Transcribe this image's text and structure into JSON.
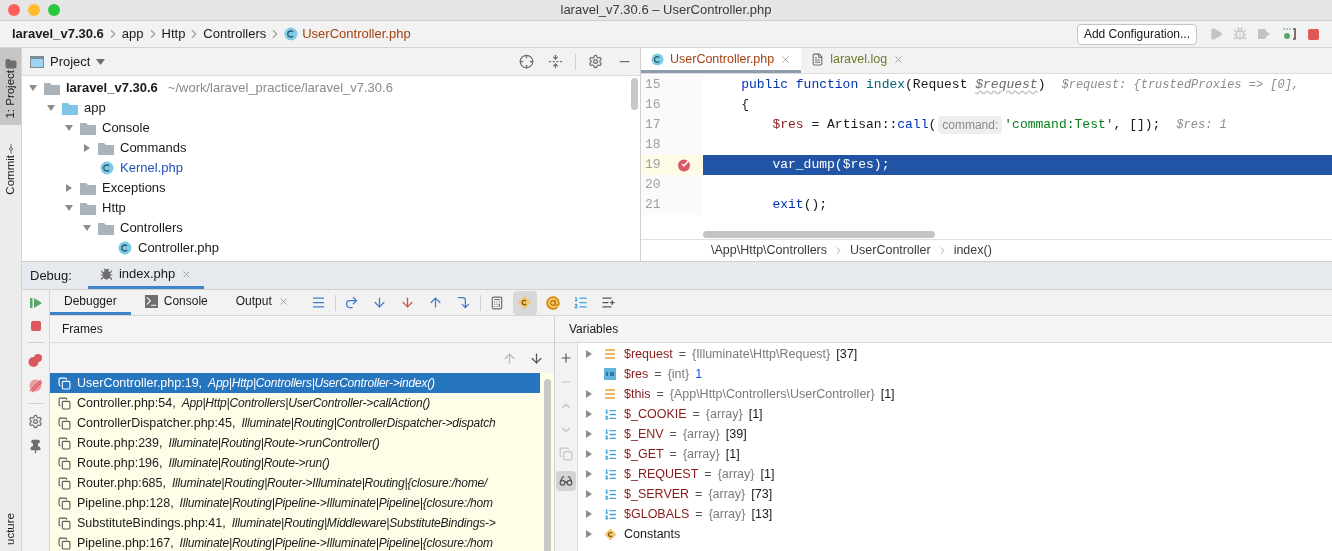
{
  "window": {
    "title": "laravel_v7.30.6 – UserController.php"
  },
  "navbar": {
    "breadcrumbs": [
      {
        "label": "laravel_v7.30.6",
        "kind": "project"
      },
      {
        "label": "app",
        "kind": "folder"
      },
      {
        "label": "Http",
        "kind": "folder"
      },
      {
        "label": "Controllers",
        "kind": "folder"
      },
      {
        "label": "UserController.php",
        "kind": "php"
      }
    ],
    "run_config": "Add Configuration..."
  },
  "tool_strip": {
    "tabs": [
      {
        "label": "1: Project",
        "selected": true,
        "kind": "project"
      },
      {
        "label": "Commit",
        "selected": false,
        "kind": "commit"
      },
      {
        "label": "ucture",
        "selected": false,
        "kind": "plain"
      }
    ]
  },
  "project": {
    "title": "Project",
    "tree": [
      {
        "label": "laravel_v7.30.6",
        "path": "~/work/laravel_practice/laravel_v7.30.6",
        "kind": "root",
        "expanded": true,
        "children": [
          {
            "label": "app",
            "kind": "source",
            "expanded": true,
            "children": [
              {
                "label": "Console",
                "kind": "folder",
                "expanded": true,
                "children": [
                  {
                    "label": "Commands",
                    "kind": "folder",
                    "expanded": false
                  },
                  {
                    "label": "Kernel.php",
                    "kind": "php",
                    "modified": true
                  }
                ]
              },
              {
                "label": "Exceptions",
                "kind": "folder",
                "expanded": false
              },
              {
                "label": "Http",
                "kind": "folder",
                "expanded": true,
                "children": [
                  {
                    "label": "Controllers",
                    "kind": "folder",
                    "expanded": true,
                    "children": [
                      {
                        "label": "Controller.php",
                        "kind": "php",
                        "modified": false
                      }
                    ]
                  }
                ]
              }
            ]
          }
        ]
      }
    ]
  },
  "editor": {
    "tabs": [
      {
        "label": "UserController.php",
        "kind": "php",
        "selected": true
      },
      {
        "label": "laravel.log",
        "kind": "log",
        "selected": false
      }
    ],
    "lines": [
      {
        "number": "15",
        "current": false,
        "breakpoint": false,
        "tokens": [
          {
            "kind": "keyword",
            "text": "    public function "
          },
          {
            "kind": "fn",
            "text": "index"
          },
          {
            "kind": "plain",
            "text": "(Request "
          },
          {
            "kind": "param",
            "text": "$request"
          },
          {
            "kind": "plain",
            "text": ")"
          },
          {
            "kind": "hint",
            "text": "$request: {trustedProxies => [0],"
          }
        ]
      },
      {
        "number": "16",
        "current": false,
        "breakpoint": false,
        "tokens": [
          {
            "kind": "plain",
            "text": "    {"
          }
        ]
      },
      {
        "number": "17",
        "current": false,
        "breakpoint": false,
        "tokens": [
          {
            "kind": "var",
            "text": "        $res"
          },
          {
            "kind": "plain",
            "text": " = Artisan::"
          },
          {
            "kind": "call",
            "text": "call"
          },
          {
            "kind": "plain",
            "text": "("
          },
          {
            "kind": "param_hint",
            "text": "command:"
          },
          {
            "kind": "string",
            "text": "'command:Test'"
          },
          {
            "kind": "plain",
            "text": ", []);"
          },
          {
            "kind": "hint",
            "text": "$res: 1"
          }
        ]
      },
      {
        "number": "18",
        "current": false,
        "breakpoint": false
      },
      {
        "number": "19",
        "current": true,
        "breakpoint": true,
        "tokens": [
          {
            "kind": "italic",
            "text": "        var_dump"
          },
          {
            "kind": "plain",
            "text": "($res);"
          }
        ]
      },
      {
        "number": "20",
        "current": false,
        "breakpoint": false
      },
      {
        "number": "21",
        "current": false,
        "breakpoint": false,
        "tokens": [
          {
            "kind": "call",
            "text": "        exit"
          },
          {
            "kind": "plain",
            "text": "();"
          }
        ]
      }
    ],
    "breadcrumbs": [
      "\\App\\Http\\Controllers",
      "UserController",
      "index()"
    ]
  },
  "debug": {
    "label": "Debug:",
    "tabs": [
      {
        "label": "index.php",
        "selected": true
      }
    ],
    "subtabs": [
      {
        "label": "Debugger",
        "kind": "debugger",
        "selected": true
      },
      {
        "label": "Console",
        "kind": "console",
        "selected": false
      },
      {
        "label": "Output",
        "kind": "output",
        "selected": false
      }
    ],
    "frames": {
      "title": "Frames",
      "items": [
        {
          "location": "UserController.php:19,",
          "method": "App|Http|Controllers|UserController->index()",
          "selected": true
        },
        {
          "location": "Controller.php:54,",
          "method": "App|Http|Controllers|UserController->callAction()",
          "selected": false
        },
        {
          "location": "ControllerDispatcher.php:45,",
          "method": "Illuminate|Routing|ControllerDispatcher->dispatch",
          "selected": false
        },
        {
          "location": "Route.php:239,",
          "method": "Illuminate|Routing|Route->runController()",
          "selected": false
        },
        {
          "location": "Route.php:196,",
          "method": "Illuminate|Routing|Route->run()",
          "selected": false
        },
        {
          "location": "Router.php:685,",
          "method": "Illuminate|Routing|Router->Illuminate|Routing|{closure:/home/",
          "selected": false
        },
        {
          "location": "Pipeline.php:128,",
          "method": "Illuminate|Routing|Pipeline->Illuminate|Pipeline|{closure:/hom",
          "selected": false
        },
        {
          "location": "SubstituteBindings.php:41,",
          "method": "Illuminate|Routing|Middleware|SubstituteBindings->",
          "selected": false
        },
        {
          "location": "Pipeline.php:167,",
          "method": "Illuminate|Routing|Pipeline->Illuminate|Pipeline|{closure:/hom",
          "selected": false
        }
      ]
    },
    "variables": {
      "title": "Variables",
      "items": [
        {
          "name": "$request",
          "assign": "=",
          "type": "{Illuminate\\Http\\Request}",
          "count": "[37]",
          "kind": "object",
          "expandable": true
        },
        {
          "name": "$res",
          "assign": "=",
          "type": "{int}",
          "value": "1",
          "kind": "int",
          "expandable": false
        },
        {
          "name": "$this",
          "assign": "=",
          "type": "{App\\Http\\Controllers\\UserController}",
          "count": "[1]",
          "kind": "object",
          "expandable": true
        },
        {
          "name": "$_COOKIE",
          "assign": "=",
          "type": "{array}",
          "count": "[1]",
          "kind": "array",
          "expandable": true
        },
        {
          "name": "$_ENV",
          "assign": "=",
          "type": "{array}",
          "count": "[39]",
          "kind": "array",
          "expandable": true
        },
        {
          "name": "$_GET",
          "assign": "=",
          "type": "{array}",
          "count": "[1]",
          "kind": "array",
          "expandable": true
        },
        {
          "name": "$_REQUEST",
          "assign": "=",
          "type": "{array}",
          "count": "[1]",
          "kind": "array",
          "expandable": true
        },
        {
          "name": "$_SERVER",
          "assign": "=",
          "type": "{array}",
          "count": "[73]",
          "kind": "array",
          "expandable": true
        },
        {
          "name": "$GLOBALS",
          "assign": "=",
          "type": "{array}",
          "count": "[13]",
          "kind": "array",
          "expandable": true
        },
        {
          "name": "Constants",
          "kind": "constants",
          "expandable": true
        }
      ]
    }
  }
}
